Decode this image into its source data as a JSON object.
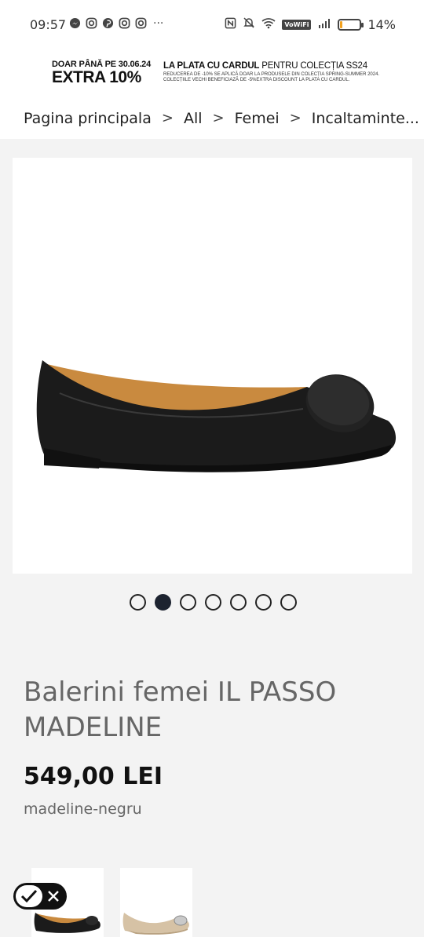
{
  "status_bar": {
    "time": "09:57",
    "left_icons": [
      "messenger-icon",
      "instagram-icon",
      "pinterest-icon",
      "instagram-icon",
      "instagram-icon"
    ],
    "more": "···",
    "vowifi": "VoWiFi",
    "battery_percent": "14%",
    "battery_level": 0.14
  },
  "promo": {
    "until": "DOAR PÂNĂ PE 30.06.24",
    "extra": "EXTRA 10%",
    "headline_bold": "LA PLATA CU CARDUL",
    "headline_rest": " PENTRU COLECȚIA SS24",
    "note_1": "REDUCEREA DE -10% SE APLICĂ DOAR LA PRODUSELE DIN COLECȚIA SPRING-SUMMER 2024.",
    "note_2": "COLECȚIILE VECHI BENEFICIAZĂ DE -5%EXTRA DISCOUNT LA PLATA CU CARDUL."
  },
  "breadcrumb": {
    "items": [
      "Pagina principala",
      "All",
      "Femei",
      "Incaltaminte"
    ],
    "separator": ">",
    "overflow": "..."
  },
  "gallery": {
    "image_count": 7,
    "active_index": 1
  },
  "product": {
    "title": "Balerini femei IL PASSO MADELINE",
    "price": "549,00 LEI",
    "sku": "madeline-negru"
  },
  "variants": [
    {
      "name": "black"
    },
    {
      "name": "beige"
    }
  ],
  "colors": {
    "shoe_black": "#1b1b1b",
    "shoe_lining": "#c98a3f",
    "dot_active": "#1d2330",
    "battery": "#f2a11f"
  }
}
